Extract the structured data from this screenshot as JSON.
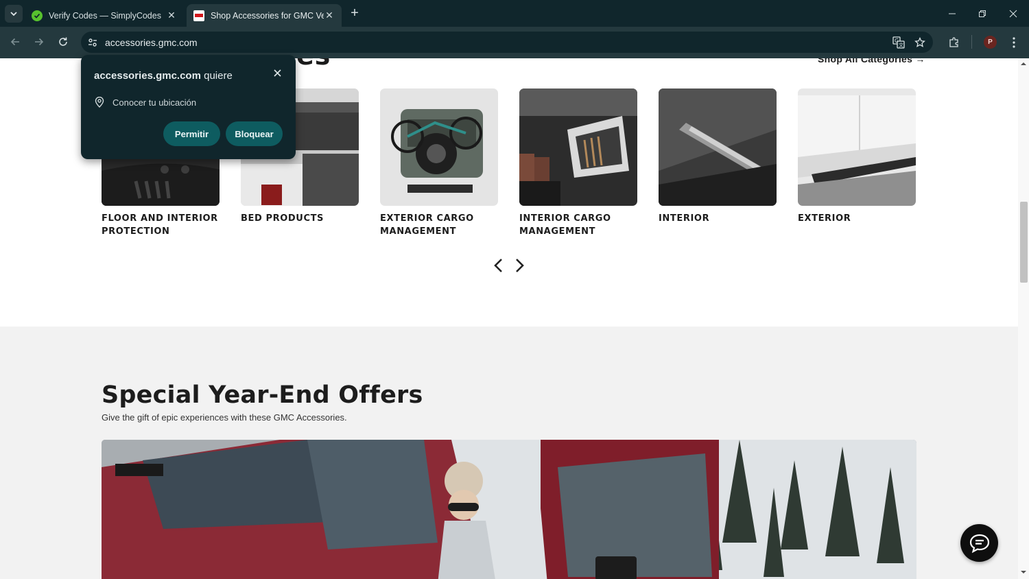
{
  "browser": {
    "tabs": [
      {
        "title": "Verify Codes — SimplyCodes",
        "active": false,
        "favicon": "simplycodes-check-icon"
      },
      {
        "title": "Shop Accessories for GMC Vehi",
        "active": true,
        "favicon": "gmc-logo-icon"
      }
    ],
    "url": "accessories.gmc.com",
    "profile_initial": "P"
  },
  "permission_popup": {
    "site": "accessories.gmc.com",
    "verb": " quiere",
    "request": "Conocer tu ubicación",
    "allow_label": "Permitir",
    "block_label": "Bloquear"
  },
  "categories_section": {
    "heading_fragment": "es",
    "shop_all_label": "Shop All Categories →",
    "items": [
      {
        "label": "FLOOR AND INTERIOR PROTECTION"
      },
      {
        "label": "BED PRODUCTS"
      },
      {
        "label": "EXTERIOR CARGO MANAGEMENT"
      },
      {
        "label": "INTERIOR CARGO MANAGEMENT"
      },
      {
        "label": "INTERIOR"
      },
      {
        "label": "EXTERIOR"
      }
    ]
  },
  "offers_section": {
    "title": "Special Year-End Offers",
    "subtitle": "Give the gift of epic experiences with these GMC Accessories."
  },
  "colors": {
    "chrome_dark": "#10262c",
    "chrome_toolbar": "#24393e",
    "popup_button": "#0e5c60",
    "offers_bg": "#f2f2f2"
  }
}
